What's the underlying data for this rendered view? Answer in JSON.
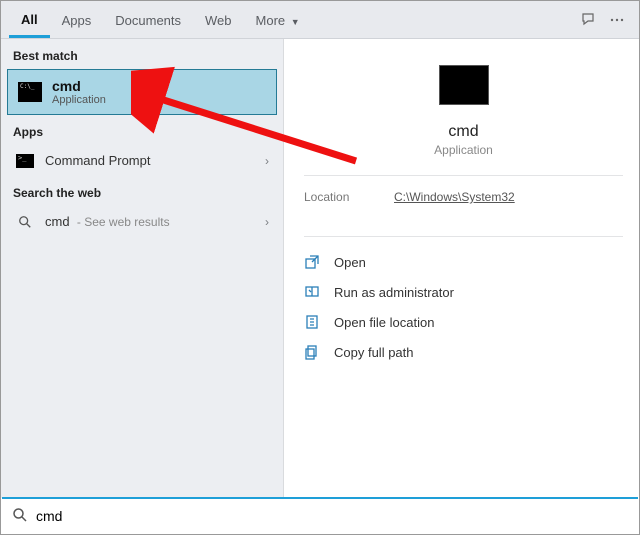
{
  "tabs": {
    "all": "All",
    "apps": "Apps",
    "documents": "Documents",
    "web": "Web",
    "more": "More"
  },
  "left": {
    "bestmatch_hdr": "Best match",
    "best": {
      "title": "cmd",
      "sub": "Application"
    },
    "apps_hdr": "Apps",
    "app_row": "Command Prompt",
    "searchweb_hdr": "Search the web",
    "web_row_prefix": "cmd",
    "web_row_suffix": " - See web results"
  },
  "right": {
    "title": "cmd",
    "sub": "Application",
    "location_label": "Location",
    "location_value": "C:\\Windows\\System32",
    "actions": {
      "open": "Open",
      "runadmin": "Run as administrator",
      "openloc": "Open file location",
      "copypath": "Copy full path"
    }
  },
  "search": {
    "value": "cmd"
  }
}
